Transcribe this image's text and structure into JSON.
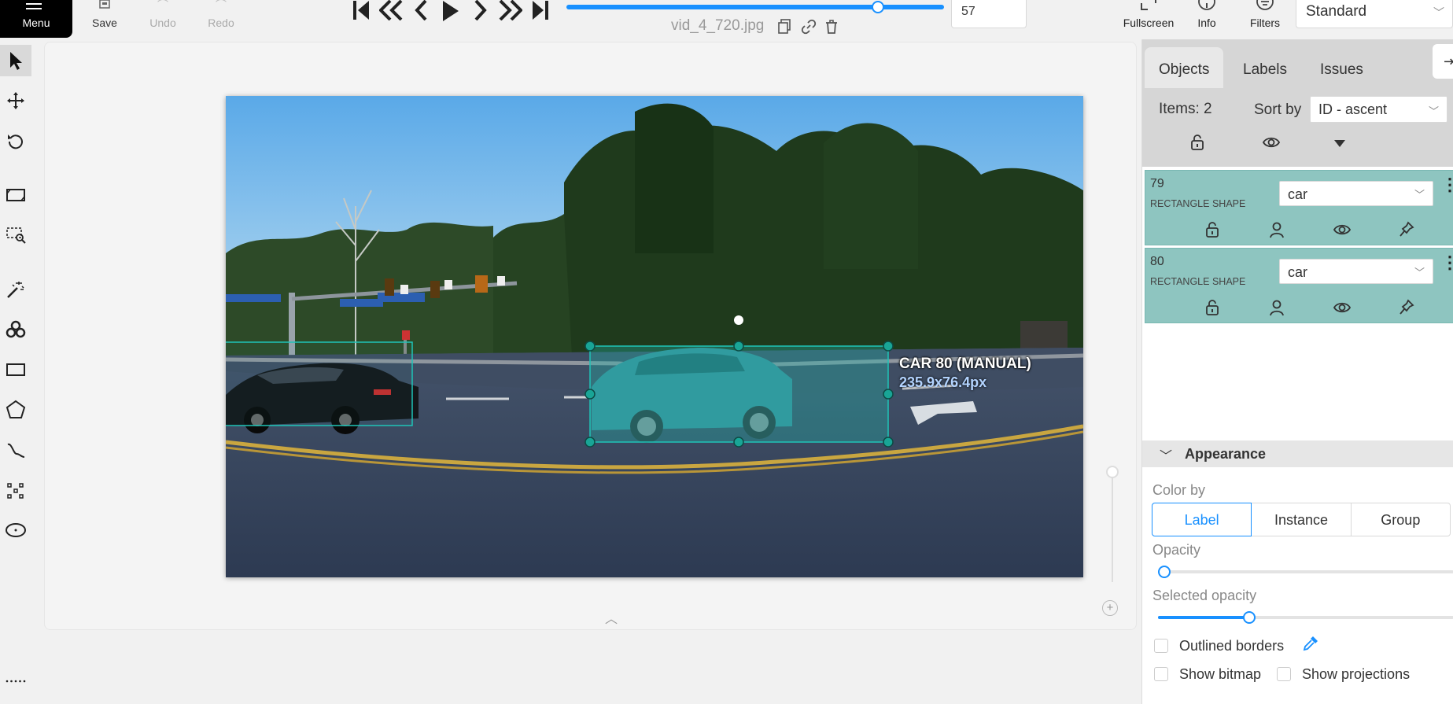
{
  "topbar": {
    "menu_label": "Menu",
    "save_label": "Save",
    "undo_label": "Undo",
    "redo_label": "Redo",
    "filename": "vid_4_720.jpg",
    "frame_number": "57",
    "frame_progress": 0.95,
    "fullscreen_label": "Fullscreen",
    "info_label": "Info",
    "filters_label": "Filters",
    "workspace": "Standard"
  },
  "canvas": {
    "shape_title": "CAR 80 (MANUAL)",
    "shape_size": "235.9x76.4px"
  },
  "sidebar": {
    "tabs": [
      "Objects",
      "Labels",
      "Issues"
    ],
    "items_count": "Items: 2",
    "sort_label": "Sort by",
    "sort_value": "ID - ascent",
    "objects": [
      {
        "id": "79",
        "type": "RECTANGLE SHAPE",
        "label": "car"
      },
      {
        "id": "80",
        "type": "RECTANGLE SHAPE",
        "label": "car"
      }
    ],
    "appearance": {
      "title": "Appearance",
      "color_by_label": "Color by",
      "color_by_options": [
        "Label",
        "Instance",
        "Group"
      ],
      "color_by_selected": "Label",
      "opacity_label": "Opacity",
      "opacity_value": 0.0,
      "selected_opacity_label": "Selected opacity",
      "selected_opacity_value": 0.3,
      "outlined_borders_label": "Outlined borders",
      "show_bitmap_label": "Show bitmap",
      "show_projections_label": "Show projections"
    }
  },
  "colors": {
    "accent": "#1890ff",
    "shape_fill": "#1fb5a8",
    "object_card": "#8ec5c0"
  }
}
